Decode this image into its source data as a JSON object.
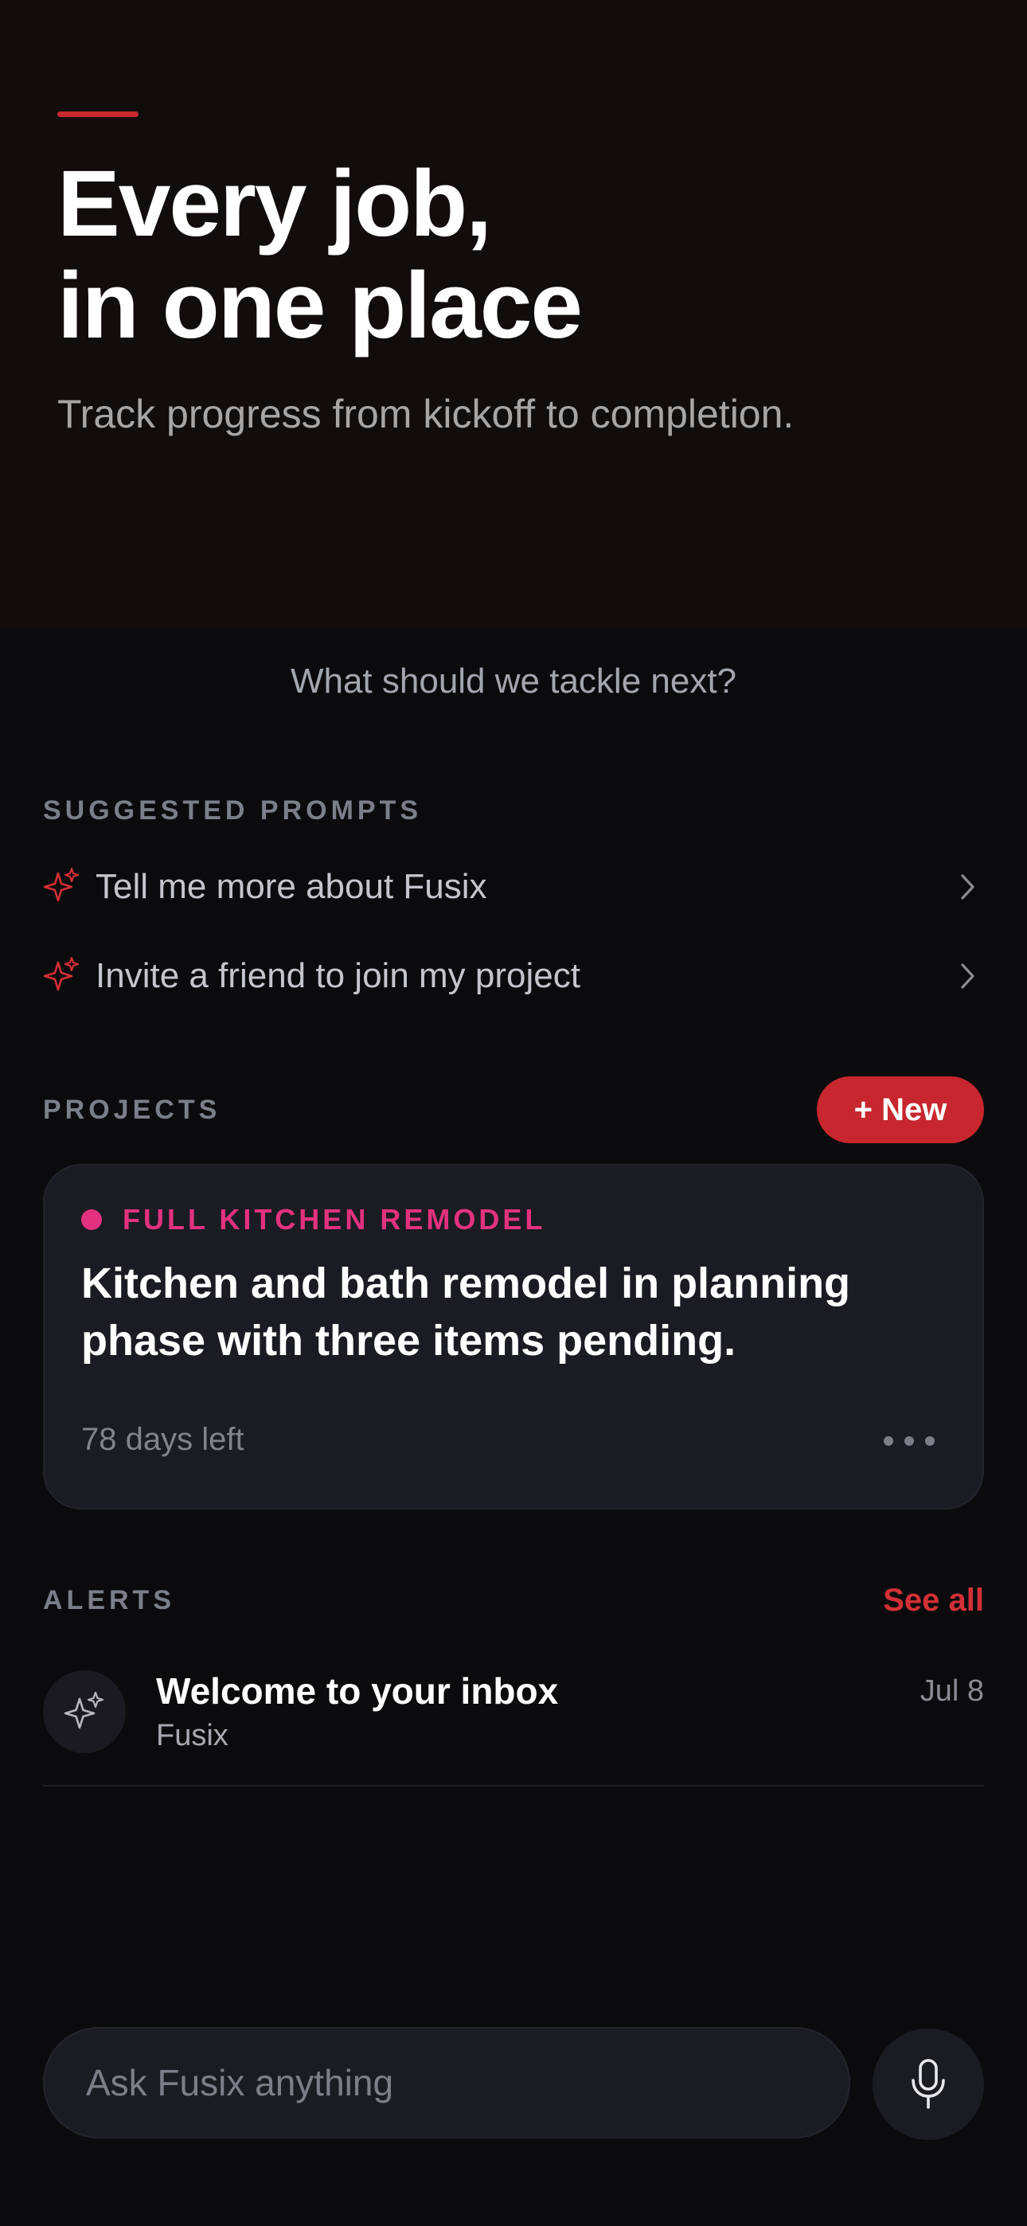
{
  "hero": {
    "title_line1": "Every job,",
    "title_line2": "in one place",
    "subtitle": "Track progress from kickoff to completion."
  },
  "tackle": {
    "text": "What should we tackle next?"
  },
  "prompts": {
    "section_label": "SUGGESTED PROMPTS",
    "items": [
      {
        "label": "Tell me more about Fusix",
        "icon": "sparkle-icon"
      },
      {
        "label": "Invite a friend to join my project",
        "icon": "sparkle-icon"
      }
    ]
  },
  "projects": {
    "section_label": "PROJECTS",
    "new_button": "+ New",
    "card": {
      "tag": "FULL KITCHEN REMODEL",
      "description": "Kitchen and bath remodel in planning phase with three items pending.",
      "days_left": "78 days left"
    }
  },
  "alerts": {
    "section_label": "ALERTS",
    "see_all": "See all",
    "items": [
      {
        "title": "Welcome to your inbox",
        "sender": "Fusix",
        "date": "Jul 8",
        "icon": "sparkle-icon"
      }
    ]
  },
  "input": {
    "placeholder": "Ask Fusix anything",
    "mic_icon": "microphone-icon"
  },
  "colors": {
    "accent": "#c8262e",
    "project_tag": "#e2327e",
    "hero_bg": "#110d0c",
    "page_bg": "#0b0b0e"
  }
}
